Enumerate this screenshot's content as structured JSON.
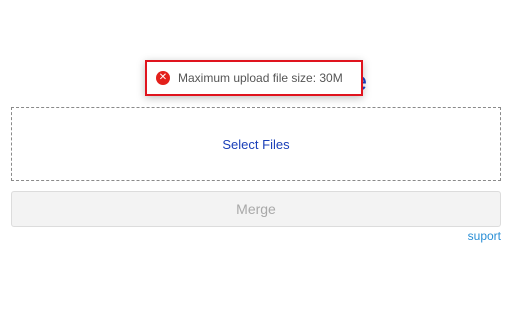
{
  "header": {
    "title": "Merge PDF Online"
  },
  "toast": {
    "message": "Maximum upload file size: 30M",
    "icon": "error-icon",
    "icon_glyph": "✕",
    "border_color": "#e0141e",
    "icon_color": "#e3201b"
  },
  "upload": {
    "select_label": "Select Files"
  },
  "actions": {
    "merge_label": "Merge",
    "merge_disabled": true
  },
  "footer": {
    "support_label": "suport"
  },
  "colors": {
    "title": "#1a44c8",
    "link": "#2a8fd6",
    "select_files": "#1a3fb8"
  }
}
